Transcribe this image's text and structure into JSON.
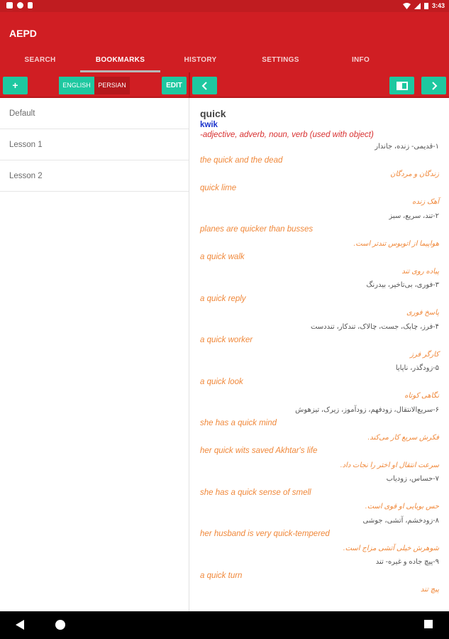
{
  "status_bar": {
    "time": "3:43"
  },
  "app": {
    "title": "AEPD"
  },
  "tabs": [
    {
      "label": "SEARCH"
    },
    {
      "label": "BOOKMARKS"
    },
    {
      "label": "HISTORY"
    },
    {
      "label": "SETTINGS"
    },
    {
      "label": "INFO"
    }
  ],
  "active_tab": "BOOKMARKS",
  "toolbar": {
    "add_label": "+",
    "lang_english": "ENGLISH",
    "lang_persian": "PERSIAN",
    "edit_label": "EDIT",
    "back_icon": "chevron-left-icon",
    "book_icon": "book-icon",
    "forward_icon": "chevron-right-icon"
  },
  "lessons": [
    {
      "label": "Default"
    },
    {
      "label": "Lesson 1"
    },
    {
      "label": "Lesson 2"
    }
  ],
  "entry": {
    "word": "quick",
    "pronunciation": "kwik",
    "pos": "-adjective, adverb, noun, verb (used with object)",
    "lines": [
      {
        "type": "def-fa",
        "text": "۱-قدیمی- زنده، جاندار"
      },
      {
        "type": "ex-en",
        "text": "the quick and the dead"
      },
      {
        "type": "ex-fa",
        "text": "زندگان و مردگان"
      },
      {
        "type": "ex-en",
        "text": "quick lime"
      },
      {
        "type": "ex-fa",
        "text": "آهک زنده"
      },
      {
        "type": "def-fa",
        "text": "۲-تند، سریع، سبز"
      },
      {
        "type": "ex-en",
        "text": "planes are quicker than busses"
      },
      {
        "type": "ex-fa",
        "text": "هواپیما از اتوبوس تندتر است."
      },
      {
        "type": "ex-en",
        "text": "a quick walk"
      },
      {
        "type": "ex-fa",
        "text": "پیاده روی تند"
      },
      {
        "type": "def-fa",
        "text": "۳-فوری، بی‌تاخیر، بیدرنگ"
      },
      {
        "type": "ex-en",
        "text": "a quick reply"
      },
      {
        "type": "ex-fa",
        "text": "پاسخ فوری"
      },
      {
        "type": "def-fa",
        "text": "۴-فرز، چابک، جست، چالاک، تندکار، تنددست"
      },
      {
        "type": "ex-en",
        "text": "a quick worker"
      },
      {
        "type": "ex-fa",
        "text": "کارگر فرز"
      },
      {
        "type": "def-fa",
        "text": "۵-زودگذر، ناپایا"
      },
      {
        "type": "ex-en",
        "text": "a quick look"
      },
      {
        "type": "ex-fa",
        "text": "نگاهی کوتاه"
      },
      {
        "type": "def-fa",
        "text": "۶-سریع‌الانتقال، زودفهم، زودآموز، زیرک، تیزهوش"
      },
      {
        "type": "ex-en",
        "text": "she has a quick mind"
      },
      {
        "type": "ex-fa",
        "text": "فکرش سریع کار می‌کند."
      },
      {
        "type": "ex-en",
        "text": "her quick wits saved Akhtar's life"
      },
      {
        "type": "ex-fa",
        "text": "سرعت انتقال او اختر را نجات داد."
      },
      {
        "type": "def-fa",
        "text": "۷-حساس، زودیاب"
      },
      {
        "type": "ex-en",
        "text": "she has a quick sense of smell"
      },
      {
        "type": "ex-fa",
        "text": "حس بویایی او قوی است."
      },
      {
        "type": "def-fa",
        "text": "۸-زودخشم، آتشی، جوشی"
      },
      {
        "type": "ex-en",
        "text": "her husband is very quick-tempered"
      },
      {
        "type": "ex-fa",
        "text": "شوهرش خیلی آتشی مزاج است."
      },
      {
        "type": "def-fa",
        "text": "۹-پیچ جاده و غیره- تند"
      },
      {
        "type": "ex-en",
        "text": "a quick turn"
      },
      {
        "type": "ex-fa",
        "text": "پیچ تند"
      }
    ]
  },
  "nav": {
    "back_icon": "triangle-back-icon",
    "home_icon": "circle-home-icon",
    "recents_icon": "square-recents-icon"
  },
  "colors": {
    "primary": "#d01e23",
    "accent": "#1ec8a0",
    "example": "#f0883a",
    "pronunciation": "#1a33cc"
  }
}
